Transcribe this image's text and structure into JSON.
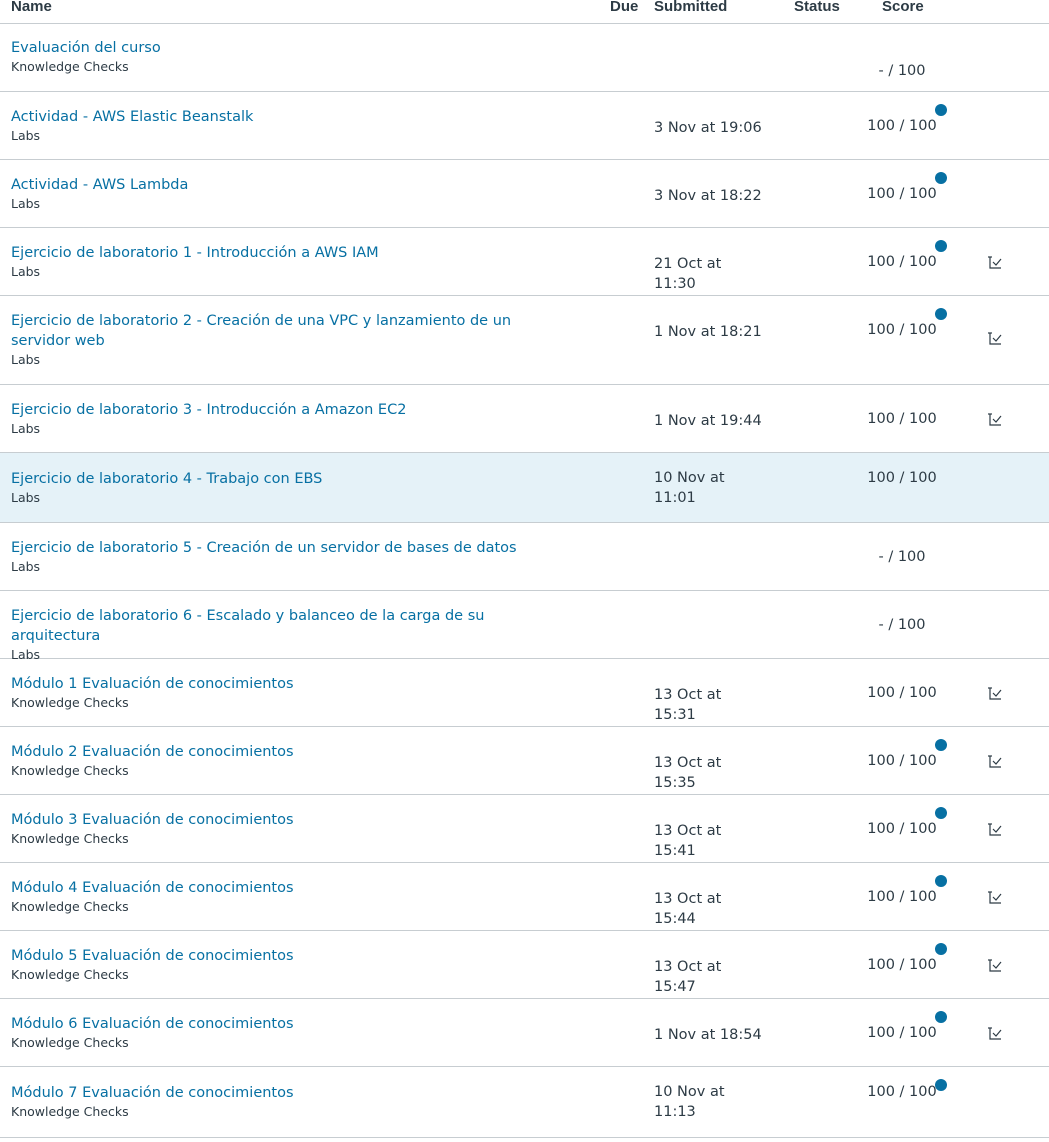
{
  "header": {
    "name": "Name",
    "due": "Due",
    "submitted": "Submitted",
    "status": "Status",
    "score": "Score"
  },
  "colors": {
    "link": "#0770a3",
    "dot": "#0770a3",
    "highlight": "#e5f2f8"
  },
  "rows": [
    {
      "title": "Evaluación del curso",
      "group": "Knowledge Checks",
      "submitted": "",
      "score": "- / 100",
      "dot": false,
      "rubric": false
    },
    {
      "title": "Actividad - AWS Elastic Beanstalk",
      "group": "Labs",
      "submitted": "3 Nov at 19:06",
      "score": "100 / 100",
      "dot": true,
      "rubric": false
    },
    {
      "title": "Actividad - AWS Lambda",
      "group": "Labs",
      "submitted": "3 Nov at 18:22",
      "score": "100 / 100",
      "dot": true,
      "rubric": false
    },
    {
      "title": "Ejercicio de laboratorio 1 - Introducción a AWS IAM",
      "group": "Labs",
      "submitted": "21 Oct at 11:30",
      "score": "100 / 100",
      "dot": true,
      "rubric": true
    },
    {
      "title": "Ejercicio de laboratorio 2 - Creación de una VPC y lanzamiento de un servidor web",
      "group": "Labs",
      "submitted": "1 Nov at 18:21",
      "score": "100 / 100",
      "dot": true,
      "rubric": true
    },
    {
      "title": "Ejercicio de laboratorio 3 - Introducción a Amazon EC2",
      "group": "Labs",
      "submitted": "1 Nov at 19:44",
      "score": "100 / 100",
      "dot": false,
      "rubric": true
    },
    {
      "title": "Ejercicio de laboratorio 4 - Trabajo con EBS",
      "group": "Labs",
      "submitted": "10 Nov at 11:01",
      "score": "100 / 100",
      "dot": false,
      "rubric": false,
      "highlight": true
    },
    {
      "title": "Ejercicio de laboratorio 5 - Creación de un servidor de bases de datos",
      "group": "Labs",
      "submitted": "",
      "score": "- / 100",
      "dot": false,
      "rubric": false
    },
    {
      "title": "Ejercicio de laboratorio 6 - Escalado y balanceo de la carga de su arquitectura",
      "group": "Labs",
      "submitted": "",
      "score": "- / 100",
      "dot": false,
      "rubric": false
    },
    {
      "title": "Módulo 1 Evaluación de conocimientos",
      "group": "Knowledge Checks",
      "submitted": "13 Oct at 15:31",
      "score": "100 / 100",
      "dot": false,
      "rubric": true
    },
    {
      "title": "Módulo 2 Evaluación de conocimientos",
      "group": "Knowledge Checks",
      "submitted": "13 Oct at 15:35",
      "score": "100 / 100",
      "dot": true,
      "rubric": true
    },
    {
      "title": "Módulo 3 Evaluación de conocimientos",
      "group": "Knowledge Checks",
      "submitted": "13 Oct at 15:41",
      "score": "100 / 100",
      "dot": true,
      "rubric": true
    },
    {
      "title": "Módulo 4 Evaluación de conocimientos",
      "group": "Knowledge Checks",
      "submitted": "13 Oct at 15:44",
      "score": "100 / 100",
      "dot": true,
      "rubric": true
    },
    {
      "title": "Módulo 5 Evaluación de conocimientos",
      "group": "Knowledge Checks",
      "submitted": "13 Oct at 15:47",
      "score": "100 / 100",
      "dot": true,
      "rubric": true
    },
    {
      "title": "Módulo 6 Evaluación de conocimientos",
      "group": "Knowledge Checks",
      "submitted": "1 Nov at 18:54",
      "score": "100 / 100",
      "dot": true,
      "rubric": true
    },
    {
      "title": "Módulo 7 Evaluación de conocimientos",
      "group": "Knowledge Checks",
      "submitted": "10 Nov at 11:13",
      "score": "100 / 100",
      "dot": true,
      "rubric": false
    }
  ]
}
